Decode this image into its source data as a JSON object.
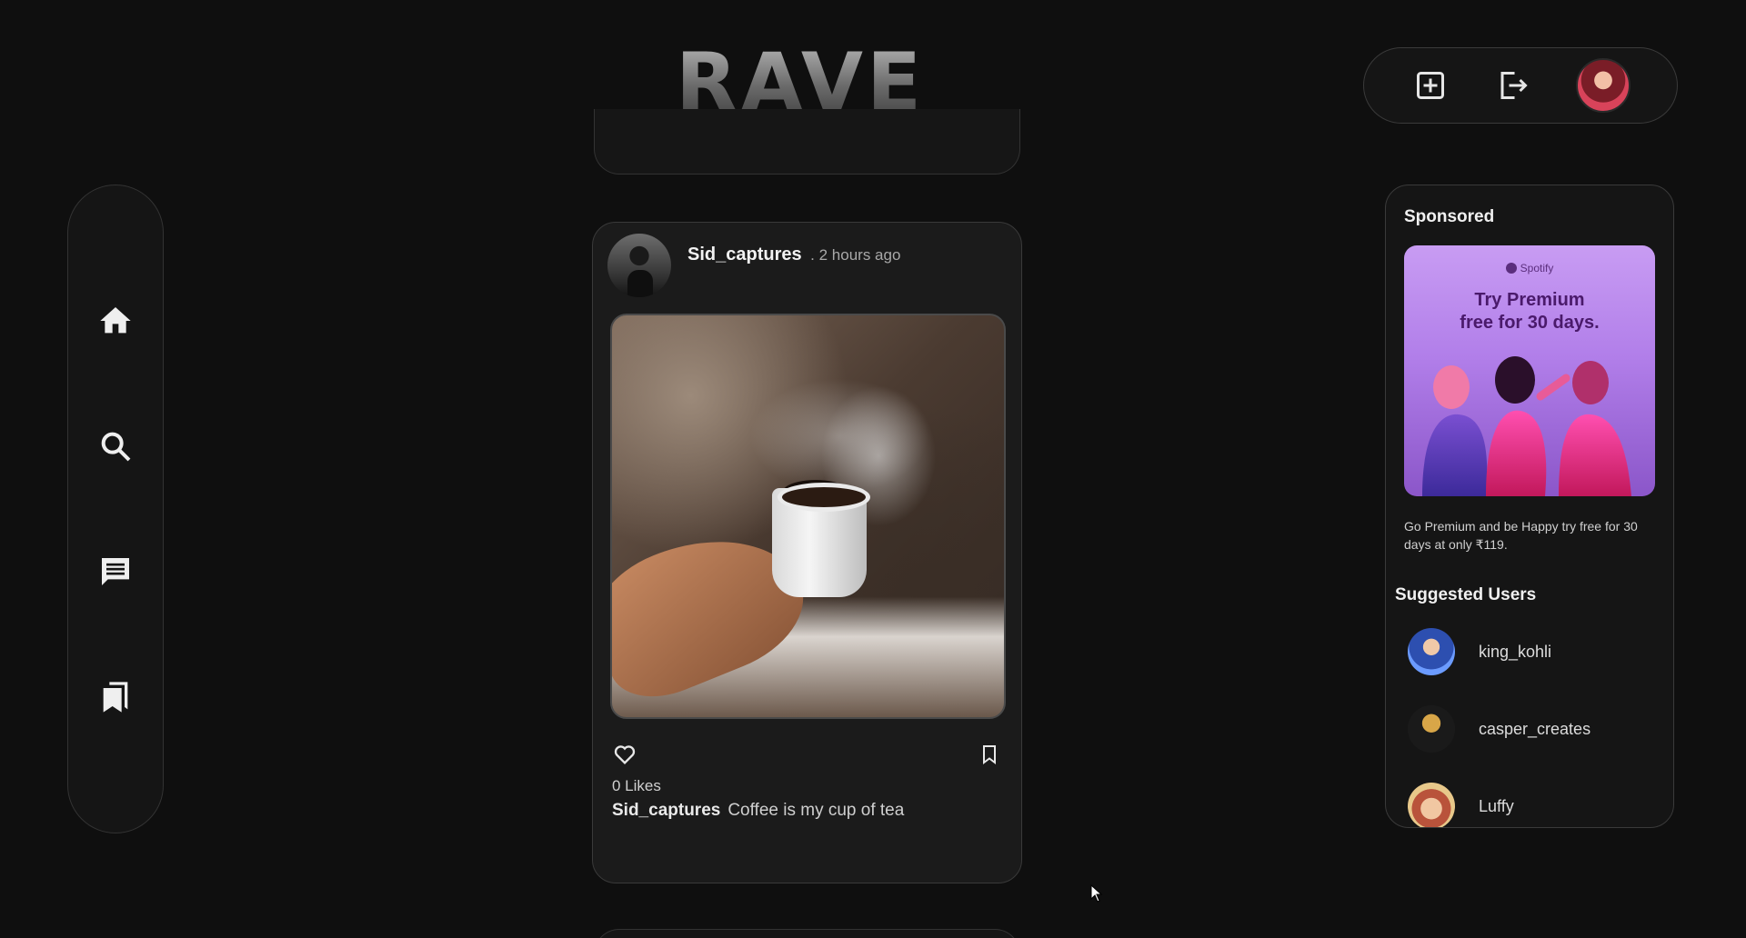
{
  "app": {
    "logo": "RAVE"
  },
  "top_actions": {
    "create_icon": "plus-square-icon",
    "logout_icon": "logout-icon",
    "avatar": "profile-avatar"
  },
  "sidebar": {
    "items": [
      {
        "name": "home",
        "icon": "home-icon"
      },
      {
        "name": "search",
        "icon": "search-icon"
      },
      {
        "name": "messages",
        "icon": "chat-icon"
      },
      {
        "name": "saved",
        "icon": "bookmarks-icon"
      }
    ]
  },
  "post": {
    "username": "Sid_captures",
    "time": ". 2 hours ago",
    "likes": "0 Likes",
    "caption_user": "Sid_captures",
    "caption": "Coffee is my cup of tea"
  },
  "right_panel": {
    "sponsored_title": "Sponsored",
    "ad": {
      "brand": "Spotify",
      "headline": "Try Premium\nfree for 30 days.",
      "description": "Go Premium and be Happy try free for 30 days at only ₹119."
    },
    "suggested_title": "Suggested Users",
    "users": [
      {
        "name": "king_kohli",
        "color": "#3b6fd6"
      },
      {
        "name": "casper_creates",
        "color": "#b8903a"
      },
      {
        "name": "Luffy",
        "color": "#c4705a"
      }
    ]
  }
}
